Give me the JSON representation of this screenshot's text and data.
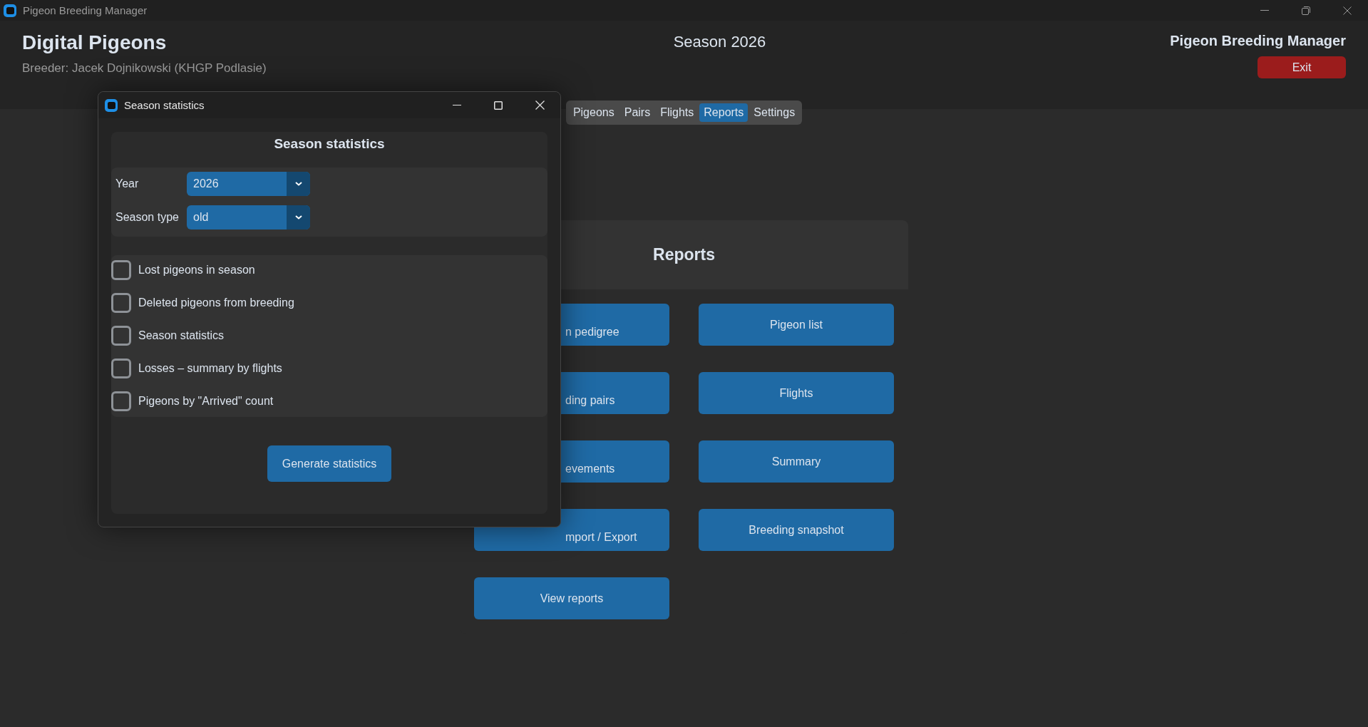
{
  "window": {
    "title": "Pigeon Breeding Manager"
  },
  "header": {
    "app_name": "Digital Pigeons",
    "breeder": "Breeder: Jacek Dojnikowski (KHGP Podlasie)",
    "season": "Season 2026",
    "title": "Pigeon Breeding Manager",
    "exit_button": "Exit"
  },
  "tabs": [
    {
      "label": "Pigeons",
      "selected": false
    },
    {
      "label": "Pairs",
      "selected": false
    },
    {
      "label": "Flights",
      "selected": false
    },
    {
      "label": "Reports",
      "selected": true
    },
    {
      "label": "Settings",
      "selected": false
    }
  ],
  "reports": {
    "title": "Reports",
    "buttons": [
      {
        "label": "n pedigree",
        "covered": true
      },
      {
        "label": "Pigeon list",
        "covered": false
      },
      {
        "label": "ding pairs",
        "covered": true
      },
      {
        "label": "Flights",
        "covered": false
      },
      {
        "label": "evements",
        "covered": true
      },
      {
        "label": "Summary",
        "covered": false
      },
      {
        "label": "mport / Export",
        "covered": true
      },
      {
        "label": "Breeding snapshot",
        "covered": false
      },
      {
        "label": "View reports",
        "covered": false
      }
    ]
  },
  "dialog": {
    "title": "Season statistics",
    "heading": "Season statistics",
    "fields": [
      {
        "label": "Year",
        "value": "2026"
      },
      {
        "label": "Season type",
        "value": "old"
      }
    ],
    "options": [
      {
        "label": "Lost pigeons in season",
        "checked": false
      },
      {
        "label": "Deleted pigeons from breeding",
        "checked": false
      },
      {
        "label": "Season statistics",
        "checked": false
      },
      {
        "label": "Losses – summary by flights",
        "checked": false
      },
      {
        "label": "Pigeons by \"Arrived\" count",
        "checked": false
      }
    ],
    "button": "Generate statistics"
  }
}
